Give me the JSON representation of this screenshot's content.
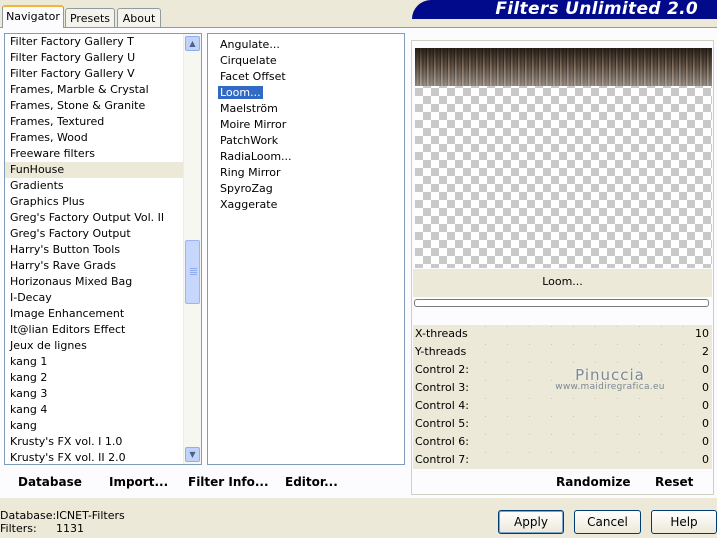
{
  "tabs": [
    "Navigator",
    "Presets",
    "About"
  ],
  "brand_title": "Filters Unlimited 2.0",
  "categories": [
    "Filter Factory Gallery T",
    "Filter Factory Gallery U",
    "Filter Factory Gallery V",
    "Frames, Marble & Crystal",
    "Frames, Stone & Granite",
    "Frames, Textured",
    "Frames, Wood",
    "Freeware filters",
    "FunHouse",
    "Gradients",
    "Graphics Plus",
    "Greg's Factory Output Vol. II",
    "Greg's Factory Output",
    "Harry's Button Tools",
    "Harry's Rave Grads",
    "Horizonaus Mixed Bag",
    "I-Decay",
    "Image Enhancement",
    "It@lian Editors Effect",
    "Jeux de lignes",
    "kang 1",
    "kang 2",
    "kang 3",
    "kang 4",
    "kang",
    "Krusty's FX vol. I 1.0",
    "Krusty's FX vol. II 2.0"
  ],
  "selected_category": "FunHouse",
  "filters": [
    "Angulate...",
    "Cirquelate",
    "Facet Offset",
    "Loom...",
    "Maelström",
    "Moire Mirror",
    "PatchWork",
    "RadiaLoom...",
    "Ring Mirror",
    "SpyroZag",
    "Xaggerate"
  ],
  "selected_filter": "Loom...",
  "preview_filter_name": "Loom...",
  "controls": [
    {
      "label": "X-threads",
      "value": "10"
    },
    {
      "label": "Y-threads",
      "value": "2"
    },
    {
      "label": "Control 2:",
      "value": "0"
    },
    {
      "label": "Control 3:",
      "value": "0"
    },
    {
      "label": "Control 4:",
      "value": "0"
    },
    {
      "label": "Control 5:",
      "value": "0"
    },
    {
      "label": "Control 6:",
      "value": "0"
    },
    {
      "label": "Control 7:",
      "value": "0"
    }
  ],
  "watermark": {
    "name": "Pinuccia",
    "site": "www.maidiregrafica.eu"
  },
  "links": {
    "database": "Database",
    "import": "Import...",
    "filter_info": "Filter Info...",
    "editor": "Editor...",
    "randomize": "Randomize",
    "reset": "Reset"
  },
  "footer": {
    "database_label": "Database:",
    "database_value": "ICNET-Filters",
    "filters_label": "Filters:",
    "filters_value": "1131"
  },
  "buttons": {
    "apply": "Apply",
    "cancel": "Cancel",
    "help": "Help"
  },
  "colors": {
    "brand": "#000a8a",
    "selection": "#316ac5",
    "panel": "#ece9d8"
  }
}
